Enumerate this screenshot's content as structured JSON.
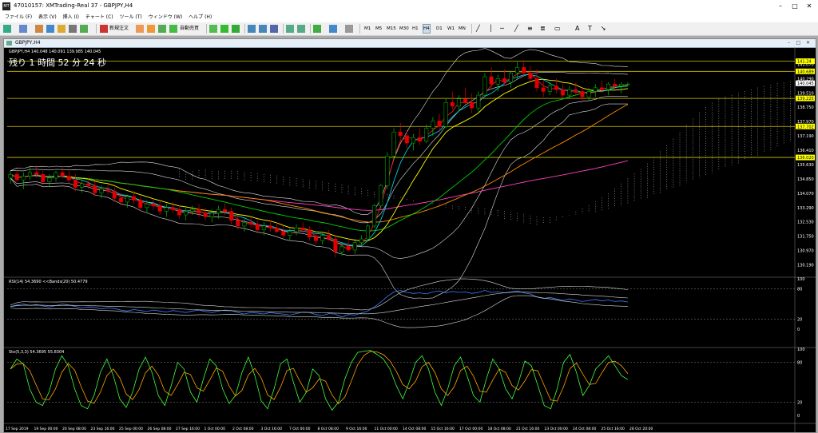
{
  "window": {
    "title": "47010157: XMTrading-Real 37 - GBPJPY,H4"
  },
  "menu": [
    "ファイル (F)",
    "表示 (V)",
    "挿入 (I)",
    "チャート (C)",
    "ツール (T)",
    "ウィンドウ (W)",
    "ヘルプ (H)"
  ],
  "toolbar": {
    "new_order": "新規注文",
    "auto_trade": "自動売買",
    "timeframes": [
      "M1",
      "M5",
      "M15",
      "M30",
      "H1",
      "H4",
      "D1",
      "W1",
      "MN"
    ],
    "active_timeframe": "H4"
  },
  "chart_window": {
    "title": "GBPJPY,H4"
  },
  "chart_data": {
    "type": "candlestick",
    "symbol_line": "GBPJPY,H4  140.048 140.091 139.985 140.045",
    "countdown": "残り 1 時間 52 分 24 秒",
    "price_ticks": [
      "141.070",
      "140.290",
      "139.510",
      "138.750",
      "137.970",
      "137.190",
      "136.410",
      "135.630",
      "134.850",
      "134.070",
      "133.290",
      "132.530",
      "131.750",
      "130.970",
      "130.190"
    ],
    "current_price": "140.045",
    "hlines": [
      {
        "price": 141.24,
        "label": "141.24"
      },
      {
        "price": 140.689,
        "label": "140.689"
      },
      {
        "price": 139.225,
        "label": "139.225"
      },
      {
        "price": 137.702,
        "label": "137.702"
      },
      {
        "price": 136.02,
        "label": "136.020"
      }
    ],
    "ylim": [
      130.0,
      141.7
    ],
    "candles": [
      [
        134.9,
        135.3,
        134.6,
        135.1
      ],
      [
        135.1,
        135.4,
        134.7,
        134.8
      ],
      [
        134.8,
        135.2,
        134.3,
        135.0
      ],
      [
        135.0,
        135.5,
        134.8,
        135.2
      ],
      [
        135.2,
        135.6,
        134.9,
        135.1
      ],
      [
        135.1,
        135.3,
        134.5,
        134.7
      ],
      [
        134.7,
        135.1,
        134.4,
        134.9
      ],
      [
        134.9,
        135.3,
        134.7,
        135.2
      ],
      [
        135.2,
        135.5,
        134.9,
        135.0
      ],
      [
        135.0,
        135.4,
        134.6,
        134.8
      ],
      [
        134.8,
        135.1,
        134.2,
        134.4
      ],
      [
        134.4,
        134.8,
        134.1,
        134.6
      ],
      [
        134.6,
        134.9,
        134.3,
        134.5
      ],
      [
        134.5,
        134.7,
        133.9,
        134.1
      ],
      [
        134.1,
        134.5,
        133.8,
        134.3
      ],
      [
        134.3,
        134.6,
        134.0,
        134.2
      ],
      [
        134.2,
        134.4,
        133.6,
        133.8
      ],
      [
        133.8,
        134.1,
        133.4,
        133.6
      ],
      [
        133.6,
        134.0,
        133.3,
        133.9
      ],
      [
        133.9,
        134.2,
        133.5,
        133.7
      ],
      [
        133.7,
        133.9,
        133.1,
        133.3
      ],
      [
        133.3,
        133.7,
        133.0,
        133.5
      ],
      [
        133.5,
        133.8,
        133.2,
        133.4
      ],
      [
        133.4,
        133.6,
        132.9,
        133.1
      ],
      [
        133.1,
        133.5,
        132.8,
        133.3
      ],
      [
        133.3,
        133.6,
        133.0,
        133.2
      ],
      [
        133.2,
        133.4,
        132.7,
        132.9
      ],
      [
        132.9,
        133.3,
        132.6,
        133.1
      ],
      [
        133.1,
        133.4,
        132.9,
        133.2
      ],
      [
        133.2,
        133.5,
        132.8,
        133.0
      ],
      [
        133.0,
        133.3,
        132.6,
        132.8
      ],
      [
        132.8,
        133.2,
        132.5,
        133.0
      ],
      [
        133.0,
        133.4,
        132.7,
        133.2
      ],
      [
        133.2,
        133.5,
        132.9,
        133.1
      ],
      [
        133.1,
        133.3,
        132.4,
        132.6
      ],
      [
        132.6,
        132.9,
        132.1,
        132.3
      ],
      [
        132.3,
        132.7,
        132.0,
        132.5
      ],
      [
        132.5,
        132.8,
        132.2,
        132.4
      ],
      [
        132.4,
        132.6,
        131.9,
        132.1
      ],
      [
        132.1,
        132.5,
        131.8,
        132.3
      ],
      [
        132.3,
        132.6,
        132.0,
        132.2
      ],
      [
        132.2,
        132.5,
        131.9,
        132.0
      ],
      [
        132.0,
        132.3,
        131.6,
        131.8
      ],
      [
        131.8,
        132.2,
        131.5,
        132.0
      ],
      [
        132.0,
        132.4,
        131.8,
        132.2
      ],
      [
        132.2,
        132.5,
        131.9,
        132.1
      ],
      [
        132.1,
        132.3,
        131.5,
        131.7
      ],
      [
        131.7,
        132.0,
        131.3,
        131.5
      ],
      [
        131.5,
        131.9,
        131.3,
        131.8
      ],
      [
        131.8,
        132.1,
        131.5,
        131.6
      ],
      [
        131.6,
        131.8,
        130.6,
        130.9
      ],
      [
        130.9,
        131.4,
        130.7,
        131.2
      ],
      [
        131.2,
        131.5,
        130.9,
        131.0
      ],
      [
        131.0,
        131.5,
        130.8,
        131.4
      ],
      [
        131.4,
        131.8,
        131.2,
        131.6
      ],
      [
        131.6,
        132.4,
        131.5,
        132.3
      ],
      [
        132.3,
        133.5,
        132.2,
        133.4
      ],
      [
        133.4,
        134.6,
        133.2,
        134.5
      ],
      [
        134.5,
        136.3,
        134.3,
        136.1
      ],
      [
        136.1,
        137.6,
        135.9,
        137.4
      ],
      [
        137.4,
        137.9,
        136.8,
        137.2
      ],
      [
        137.2,
        137.5,
        136.5,
        136.8
      ],
      [
        136.8,
        137.3,
        136.4,
        137.1
      ],
      [
        137.1,
        137.6,
        136.7,
        136.9
      ],
      [
        136.9,
        137.8,
        136.8,
        137.6
      ],
      [
        137.6,
        138.2,
        137.2,
        138.0
      ],
      [
        138.0,
        138.4,
        137.4,
        137.7
      ],
      [
        137.7,
        139.2,
        137.6,
        139.0
      ],
      [
        139.0,
        139.6,
        138.6,
        138.8
      ],
      [
        138.8,
        139.4,
        138.5,
        139.2
      ],
      [
        139.2,
        139.8,
        138.9,
        139.0
      ],
      [
        139.0,
        139.5,
        138.4,
        138.7
      ],
      [
        138.7,
        139.6,
        138.5,
        139.4
      ],
      [
        139.4,
        140.6,
        139.3,
        140.4
      ],
      [
        140.4,
        140.9,
        139.8,
        140.0
      ],
      [
        140.0,
        140.5,
        139.6,
        140.3
      ],
      [
        140.3,
        140.8,
        139.9,
        140.1
      ],
      [
        140.1,
        140.7,
        139.8,
        140.6
      ],
      [
        140.6,
        141.2,
        140.3,
        140.9
      ],
      [
        140.9,
        141.3,
        140.4,
        140.6
      ],
      [
        140.6,
        141.0,
        140.1,
        140.3
      ],
      [
        140.3,
        140.8,
        139.6,
        139.8
      ],
      [
        139.8,
        140.2,
        139.3,
        139.6
      ],
      [
        139.6,
        140.1,
        139.4,
        139.9
      ],
      [
        139.9,
        140.3,
        139.5,
        139.7
      ],
      [
        139.7,
        140.0,
        139.2,
        139.4
      ],
      [
        139.4,
        139.9,
        139.2,
        139.7
      ],
      [
        139.7,
        140.1,
        139.4,
        139.6
      ],
      [
        139.6,
        139.8,
        139.0,
        139.3
      ],
      [
        139.3,
        139.8,
        139.1,
        139.6
      ],
      [
        139.6,
        140.0,
        139.3,
        139.8
      ],
      [
        139.8,
        140.2,
        139.5,
        139.7
      ],
      [
        139.7,
        140.1,
        139.4,
        140.0
      ],
      [
        140.0,
        140.3,
        139.7,
        139.9
      ],
      [
        139.9,
        140.1,
        139.5,
        140.0
      ],
      [
        140.0,
        140.1,
        139.9,
        140.0
      ]
    ],
    "rsi": {
      "label": "RSI(14) 54.3690  <<Bands(20) 50.4779",
      "levels": [
        "100",
        "80",
        "20",
        "0"
      ],
      "values": [
        45,
        48,
        50,
        47,
        49,
        46,
        44,
        47,
        50,
        48,
        45,
        42,
        44,
        43,
        40,
        42,
        41,
        38,
        36,
        39,
        37,
        35,
        38,
        36,
        34,
        37,
        35,
        33,
        36,
        38,
        35,
        33,
        36,
        38,
        37,
        33,
        30,
        33,
        32,
        30,
        33,
        31,
        30,
        28,
        31,
        34,
        33,
        29,
        27,
        31,
        30,
        24,
        29,
        28,
        32,
        36,
        44,
        54,
        65,
        74,
        77,
        73,
        71,
        72,
        70,
        74,
        76,
        72,
        75,
        73,
        74,
        71,
        73,
        77,
        73,
        74,
        72,
        74,
        76,
        72,
        70,
        64,
        61,
        63,
        60,
        57,
        60,
        58,
        55,
        57,
        59,
        56,
        58,
        55,
        56,
        54
      ]
    },
    "stoch": {
      "label": "Sto(5,3,3) 54.3695 55.8304",
      "levels": [
        "100",
        "80",
        "20",
        "0"
      ],
      "values": [
        70,
        85,
        78,
        40,
        20,
        15,
        35,
        70,
        90,
        75,
        40,
        15,
        10,
        30,
        65,
        85,
        60,
        25,
        12,
        35,
        70,
        88,
        65,
        30,
        15,
        45,
        80,
        70,
        35,
        20,
        55,
        85,
        75,
        40,
        18,
        30,
        65,
        88,
        60,
        22,
        10,
        40,
        78,
        85,
        50,
        20,
        35,
        70,
        60,
        25,
        8,
        20,
        55,
        80,
        95,
        97,
        98,
        92,
        85,
        70,
        45,
        25,
        50,
        80,
        90,
        70,
        35,
        15,
        40,
        75,
        88,
        60,
        30,
        20,
        55,
        85,
        70,
        40,
        25,
        50,
        82,
        75,
        45,
        15,
        10,
        40,
        80,
        92,
        65,
        30,
        45,
        70,
        80,
        90,
        75,
        60,
        54
      ]
    },
    "time_labels": [
      "17 Sep 2019",
      "19 Sep 00:00",
      "20 Sep 08:00",
      "23 Sep 16:00",
      "25 Sep 00:00",
      "26 Sep 08:00",
      "27 Sep 16:00",
      "1 Oct 00:00",
      "2 Oct 08:00",
      "3 Oct 16:00",
      "7 Oct 00:00",
      "8 Oct 08:00",
      "9 Oct 16:00",
      "11 Oct 00:00",
      "14 Oct 08:00",
      "15 Oct 16:00",
      "17 Oct 00:00",
      "18 Oct 08:00",
      "21 Oct 16:00",
      "23 Oct 00:00",
      "24 Oct 08:00",
      "25 Oct 16:00",
      "28 Oct 20:00"
    ]
  },
  "colors": {
    "bull": "#00c000",
    "bear": "#e00000",
    "ma_yellow": "#ffff00",
    "ma_orange": "#ff8c00",
    "ma_green": "#00d000",
    "ma_red": "#ff2020",
    "ma_cyan": "#00e0ff",
    "ma_magenta": "#ff40c0",
    "band": "#e0e0e0",
    "hline": "#d4c000"
  }
}
